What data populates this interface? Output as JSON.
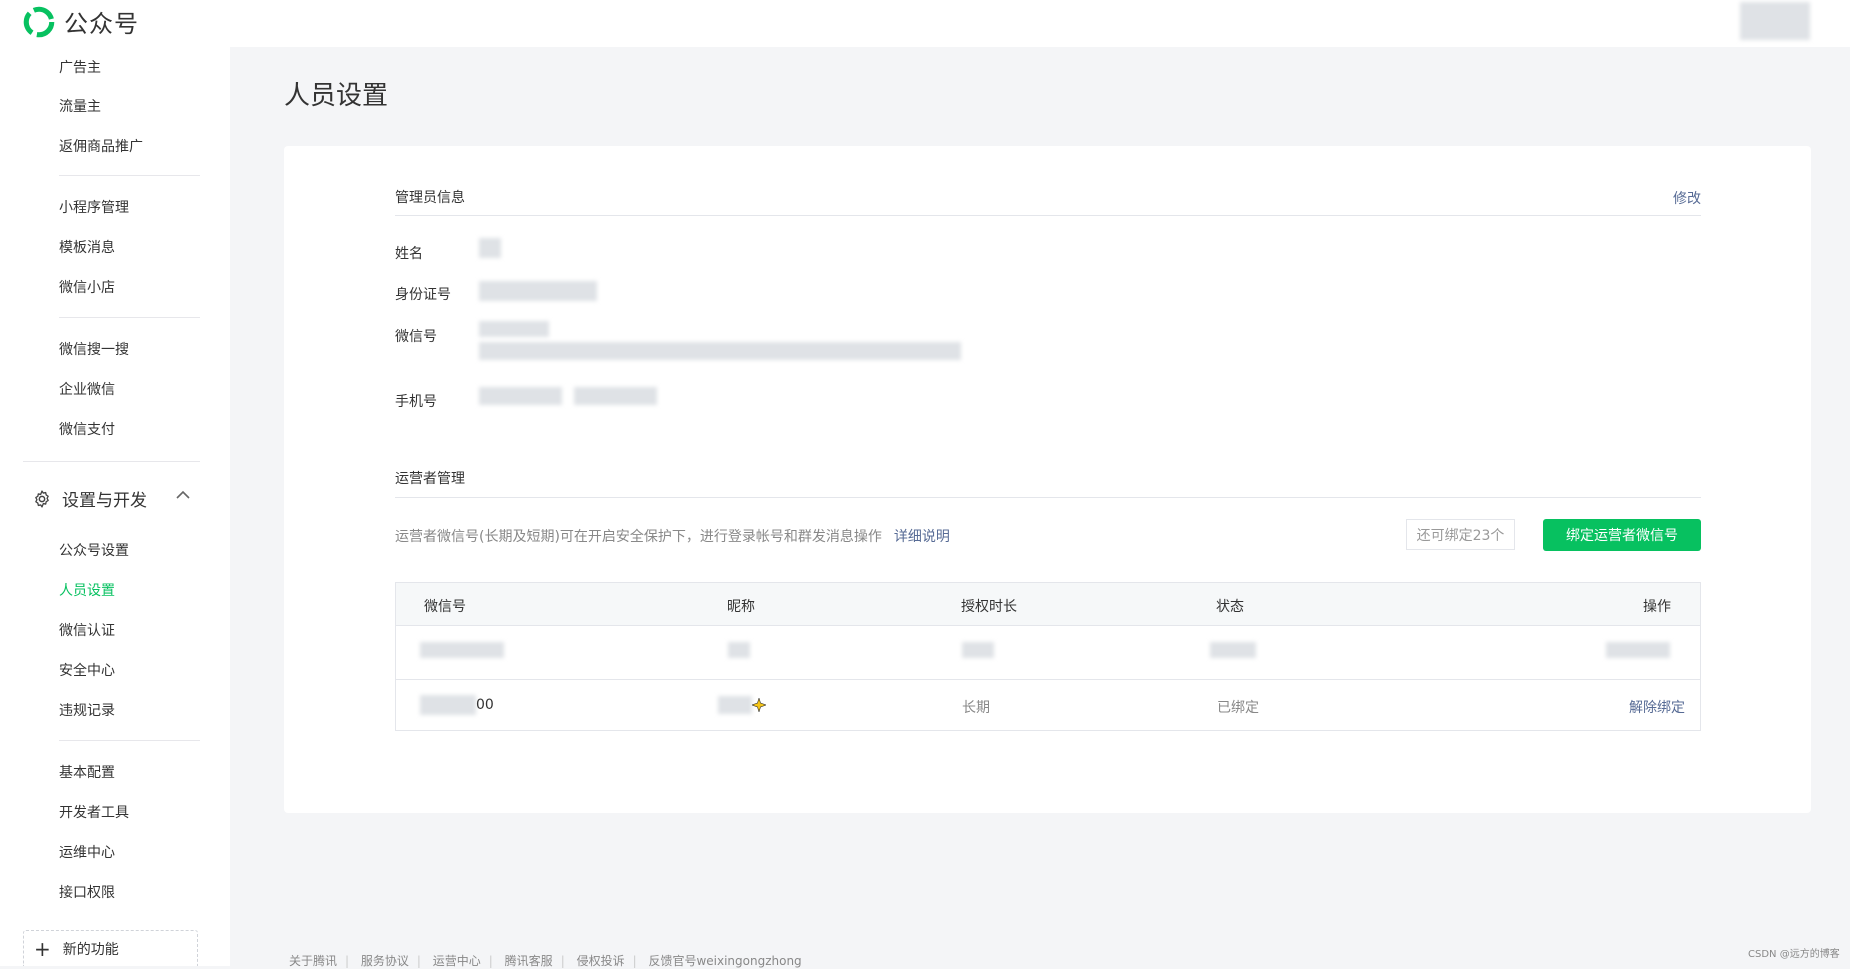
{
  "app": {
    "name": "公众号"
  },
  "sidebar": {
    "items_top": [
      {
        "label": "广告主"
      },
      {
        "label": "流量主"
      },
      {
        "label": "返佣商品推广"
      }
    ],
    "items_group2": [
      {
        "label": "小程序管理"
      },
      {
        "label": "模板消息"
      },
      {
        "label": "微信小店"
      }
    ],
    "items_group3": [
      {
        "label": "微信搜一搜"
      },
      {
        "label": "企业微信"
      },
      {
        "label": "微信支付"
      }
    ],
    "section": {
      "label": "设置与开发",
      "icon": "gear-icon"
    },
    "items_settings": [
      {
        "label": "公众号设置"
      },
      {
        "label": "人员设置",
        "active": true
      },
      {
        "label": "微信认证"
      },
      {
        "label": "安全中心"
      },
      {
        "label": "违规记录"
      }
    ],
    "items_dev": [
      {
        "label": "基本配置"
      },
      {
        "label": "开发者工具"
      },
      {
        "label": "运维中心"
      },
      {
        "label": "接口权限"
      }
    ],
    "new_feature": "新的功能"
  },
  "page": {
    "title": "人员设置"
  },
  "admin": {
    "section_title": "管理员信息",
    "edit_label": "修改",
    "fields": {
      "name": "姓名",
      "id_card": "身份证号",
      "wechat": "微信号",
      "phone": "手机号"
    }
  },
  "operators": {
    "section_title": "运营者管理",
    "description": "运营者微信号(长期及短期)可在开启安全保护下，进行登录帐号和群发消息操作",
    "detail_link": "详细说明",
    "remaining": "还可绑定23个",
    "bind_button": "绑定运营者微信号",
    "columns": [
      "微信号",
      "昵称",
      "授权时长",
      "状态",
      "操作"
    ],
    "rows": [
      {
        "wechat_suffix": "00",
        "duration": "长期",
        "status": "已绑定",
        "action": "解除绑定"
      }
    ]
  },
  "footer": {
    "links": [
      "关于腾讯",
      "服务协议",
      "运营中心",
      "腾讯客服",
      "侵权投诉",
      "反馈官号weixingongzhong"
    ]
  },
  "watermark": "CSDN @远方的博客",
  "colors": {
    "accent": "#07c160",
    "link": "#576b95"
  }
}
